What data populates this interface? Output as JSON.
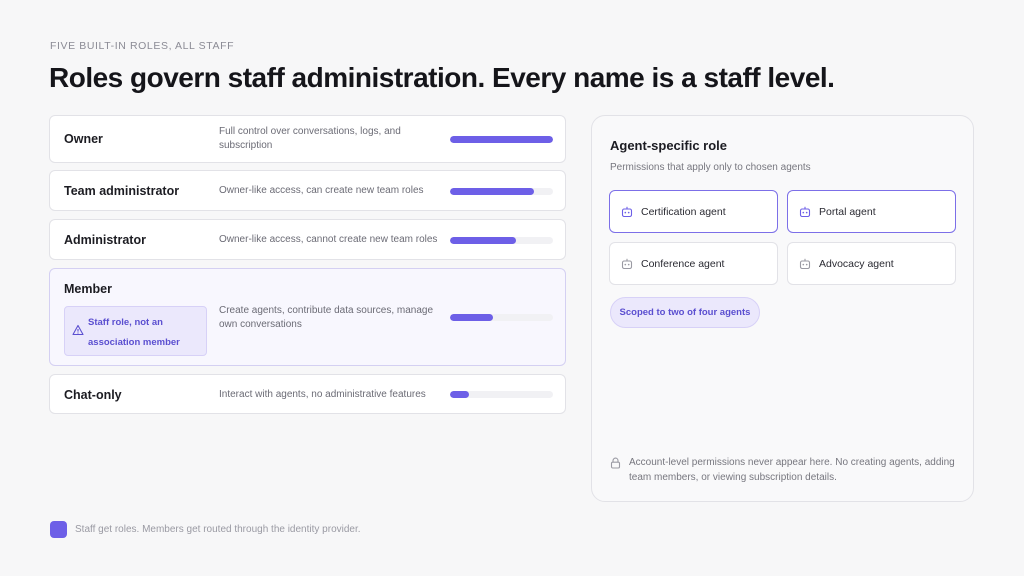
{
  "eyebrow": "FIVE BUILT-IN ROLES, ALL STAFF",
  "headline": "Roles govern staff administration. Every name is a staff level.",
  "roles": [
    {
      "name": "Owner",
      "description": "Full control over conversations, logs, and subscription",
      "level": 1.0
    },
    {
      "name": "Team administrator",
      "description": "Owner-like access, can create new team roles",
      "level": 0.82
    },
    {
      "name": "Administrator",
      "description": "Owner-like access, cannot create new team roles",
      "level": 0.64
    },
    {
      "name": "Member",
      "description": "Create agents, contribute data sources, manage own conversations",
      "level": 0.42,
      "note": "Staff role, not an association member"
    },
    {
      "name": "Chat-only",
      "description": "Interact with agents, no administrative features",
      "level": 0.18
    }
  ],
  "panel": {
    "title": "Agent-specific role",
    "subtitle": "Permissions that apply only to chosen agents",
    "agents": [
      {
        "name": "Certification agent",
        "selected": true,
        "icon": "robot-icon"
      },
      {
        "name": "Portal agent",
        "selected": true,
        "icon": "robot-icon"
      },
      {
        "name": "Conference agent",
        "selected": false,
        "icon": "robot-icon"
      },
      {
        "name": "Advocacy agent",
        "selected": false,
        "icon": "robot-icon"
      }
    ],
    "scope_label": "Scoped to two of four agents",
    "footnote": "Account-level permissions never appear here. No creating agents, adding team members, or viewing subscription details."
  },
  "legend": "Staff get roles. Members get routed through the identity provider.",
  "colors": {
    "accent": "#6d5fe7",
    "accent_soft": "#ebe8fc",
    "accent_text": "#5b4fd0"
  }
}
